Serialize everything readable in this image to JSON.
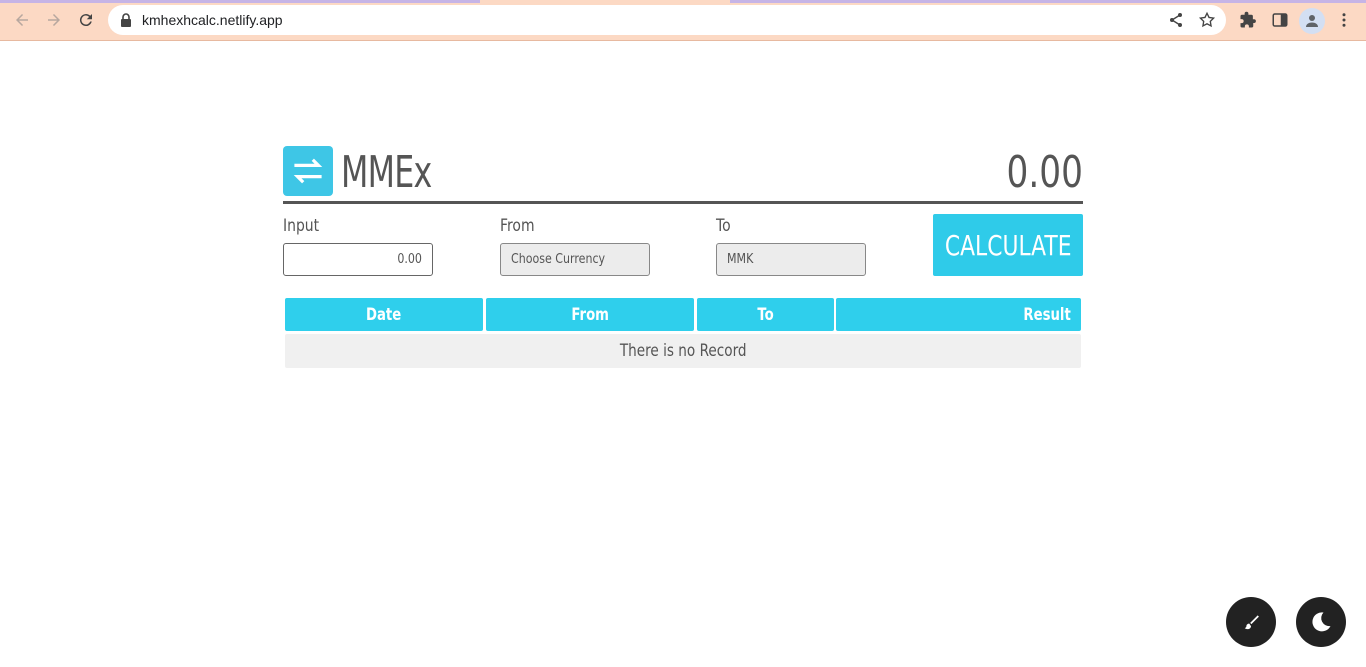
{
  "browser": {
    "url": "kmhexhcalc.netlify.app"
  },
  "app": {
    "brand": "MMEx",
    "result_display": "0.00",
    "input": {
      "label": "Input",
      "value": "0.00"
    },
    "from": {
      "label": "From",
      "selected": "Choose Currency"
    },
    "to": {
      "label": "To",
      "selected": "MMK"
    },
    "calculate_label": "CALCULATE",
    "table": {
      "columns": [
        "Date",
        "From",
        "To",
        "Result"
      ],
      "empty_text": "There is no Record"
    }
  },
  "colors": {
    "accent": "#2fcbe9",
    "text": "#555555",
    "fab": "#222222"
  },
  "icons": {
    "logo": "swap-arrows-icon",
    "theme_brush": "paint-brush-icon",
    "dark_mode": "moon-icon"
  }
}
